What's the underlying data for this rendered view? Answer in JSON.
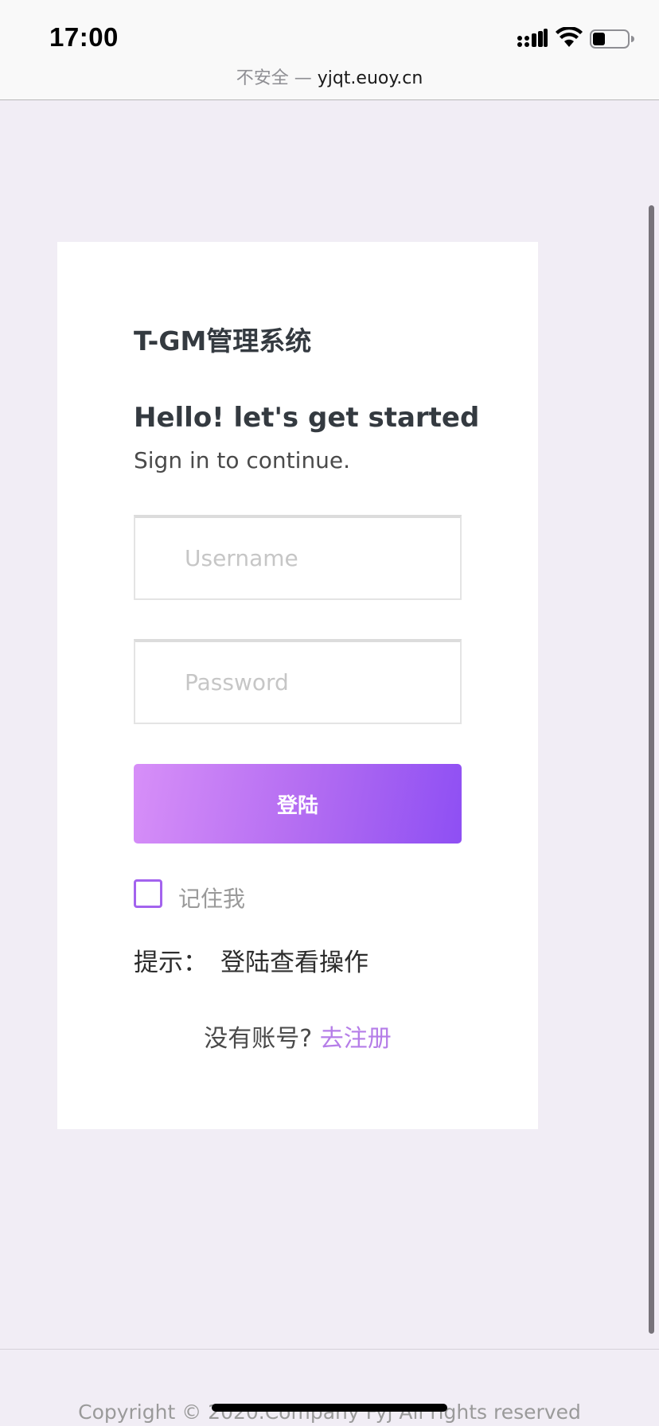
{
  "status_bar": {
    "time": "17:00",
    "icons": [
      "cellular-signal-icon",
      "wifi-icon",
      "battery-icon"
    ]
  },
  "url_bar": {
    "security_label": "不安全 —",
    "host": "yjqt.euoy.cn"
  },
  "login": {
    "brand_title": "T-GM管理系统",
    "heading": "Hello! let's get started",
    "subheading": "Sign in to continue.",
    "username_placeholder": "Username",
    "username_value": "",
    "password_placeholder": "Password",
    "password_value": "",
    "submit_label": "登陆",
    "remember_label": "记住我",
    "remember_checked": false,
    "hint_label": "提示：",
    "hint_text": "登陆查看操作",
    "register_prompt": "没有账号? ",
    "register_link": "去注册"
  },
  "footer": {
    "copyright": "Copyright © 2020.Company Fyj All rights reserved"
  },
  "colors": {
    "page_background": "#f1edf5",
    "card_background": "#ffffff",
    "accent": "#a363ee",
    "button_gradient_start": "#d78ff8",
    "button_gradient_end": "#8e4ff3",
    "link": "#b57de8"
  }
}
